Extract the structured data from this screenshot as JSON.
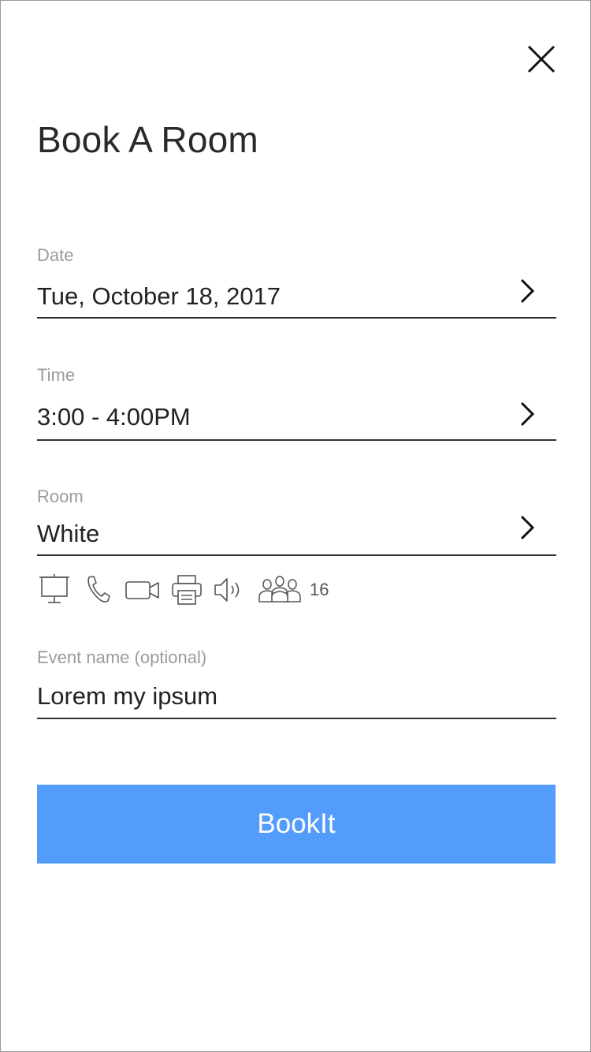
{
  "header": {
    "title": "Book A Room",
    "close_icon": "close-icon"
  },
  "form": {
    "date": {
      "label": "Date",
      "value": "Tue, October 18, 2017",
      "icon": "chevron-right-icon"
    },
    "time": {
      "label": "Time",
      "value": "3:00 - 4:00PM",
      "icon": "chevron-right-icon"
    },
    "room": {
      "label": "Room",
      "value": "White",
      "icon": "chevron-right-icon"
    },
    "amenities": {
      "icons": [
        "monitor-icon",
        "phone-icon",
        "video-camera-icon",
        "printer-icon",
        "speaker-icon",
        "people-icon"
      ],
      "capacity": "16"
    },
    "event_name": {
      "label": "Event name (optional)",
      "value": "Lorem my ipsum"
    }
  },
  "actions": {
    "book_label": "BookIt"
  },
  "colors": {
    "accent": "#539cfc",
    "label": "#9b9b9b",
    "text": "#222222",
    "border": "#9a9a9a"
  }
}
